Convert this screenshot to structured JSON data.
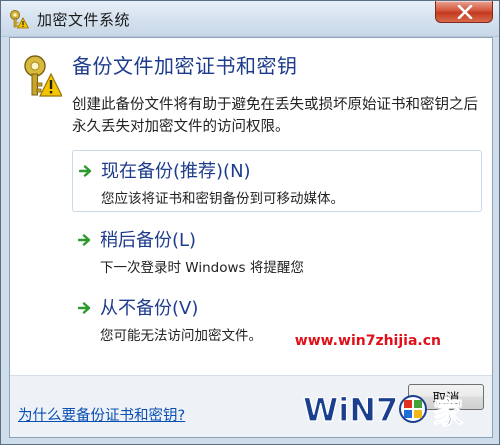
{
  "window": {
    "title": "加密文件系统"
  },
  "header": {
    "title": "备份文件加密证书和密钥",
    "description": "创建此备份文件将有助于避免在丢失或损坏原始证书和密钥之后永久丢失对加密文件的访问权限。"
  },
  "options": [
    {
      "title": "现在备份(推荐)(N)",
      "description": "您应该将证书和密钥备份到可移动媒体。"
    },
    {
      "title": "稍后备份(L)",
      "description": "下一次登录时 Windows 将提醒您"
    },
    {
      "title": "从不备份(V)",
      "description": "您可能无法访问加密文件。"
    }
  ],
  "footer": {
    "help_link": "为什么要备份证书和密钥?",
    "cancel_label": "取消"
  },
  "watermark": {
    "url": "www.win7zhijia.cn",
    "logo_text": "WiN7之家"
  },
  "colors": {
    "accent_title": "#1e3c8c",
    "arrow": "#2c9a2c",
    "link": "#0a4fb4",
    "close_button": "#c33a1f",
    "watermark": "#e0101a"
  },
  "icons": {
    "app": "key-warning-icon",
    "header": "key-warning-icon",
    "option_arrow": "green-arrow-icon",
    "close": "close-icon"
  }
}
